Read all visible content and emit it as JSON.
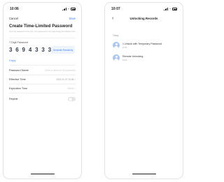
{
  "left_screen": {
    "status_bar": {
      "time": "10:06"
    },
    "nav": {
      "cancel_label": "Cancel",
      "save_label": "Save"
    },
    "title": "Create Time-Limited Password",
    "description": "Sync the password to the lock. The password is only valid during the effective time.",
    "digits_label": "7-Digit Password",
    "password": "3 6 9 4 3 3 3",
    "generate_label": "Generate Randomly",
    "copy_label": "Copy",
    "form": [
      {
        "label": "Password Name",
        "value": "Enter a name for the password",
        "kind": "placeholder"
      },
      {
        "label": "Effective Time",
        "value": "2022-11-07 10:06 >",
        "kind": "value"
      },
      {
        "label": "Expiration Time",
        "value": "Select >",
        "kind": "placeholder"
      },
      {
        "label": "Repeat",
        "value": "",
        "kind": "toggle"
      }
    ]
  },
  "right_screen": {
    "status_bar": {
      "time": "10:07"
    },
    "back_icon": "chevron-left-icon",
    "title": "Unlocking Records",
    "section": "Today",
    "records": [
      {
        "title": "1 Unlock with Temporary Password",
        "time": "10:06"
      },
      {
        "title": "Remote Unlocking",
        "time": "10:05"
      }
    ]
  },
  "colors": {
    "accent": "#3d7ff5",
    "avatar": "#a9c6f4",
    "generate_bg": "#eef4ff"
  }
}
